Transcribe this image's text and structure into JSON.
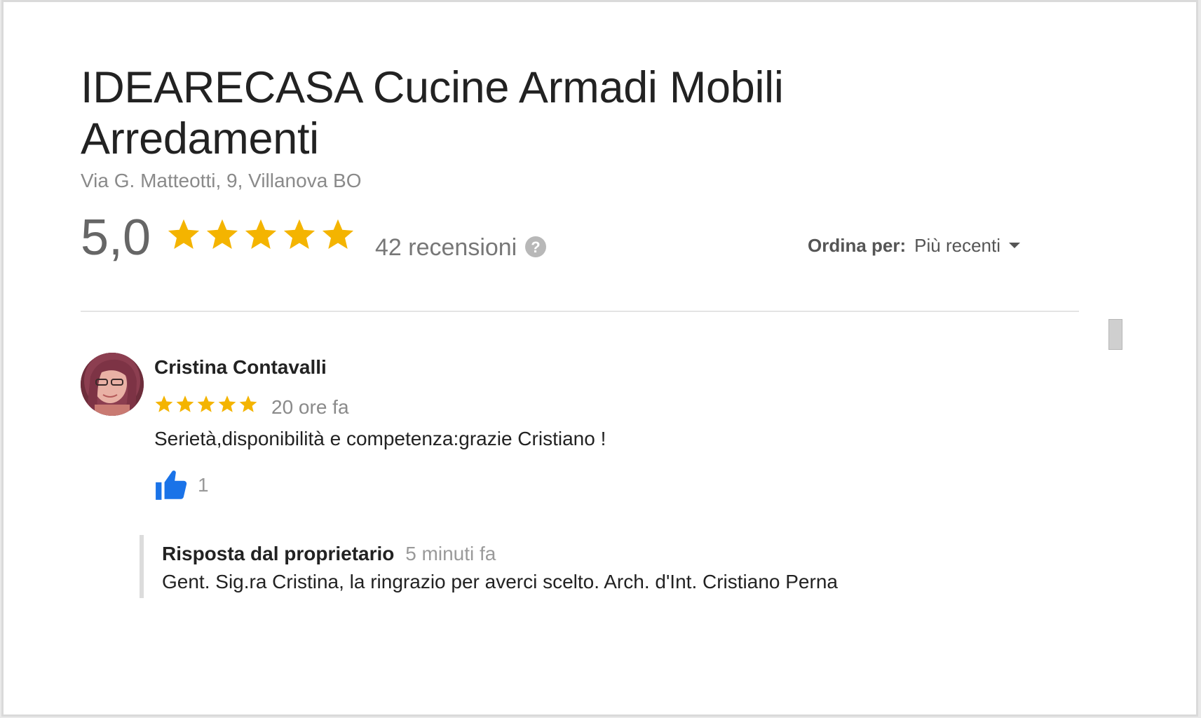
{
  "business": {
    "name": "IDEARECASA Cucine Armadi Mobili Arredamenti",
    "address": "Via G. Matteotti, 9, Villanova BO"
  },
  "summary": {
    "rating": "5,0",
    "stars": 5,
    "review_count_label": "42 recensioni",
    "help_icon": "?"
  },
  "sort": {
    "label": "Ordina per:",
    "value": "Più recenti"
  },
  "reviews": [
    {
      "author": "Cristina Contavalli",
      "stars": 5,
      "time": "20 ore fa",
      "text": "Serietà,disponibilità e competenza:grazie Cristiano !",
      "likes": "1",
      "owner_reply": {
        "label": "Risposta dal proprietario",
        "time": "5 minuti fa",
        "text": "Gent. Sig.ra Cristina, la ringrazio per averci scelto. Arch. d'Int. Cristiano Perna"
      }
    }
  ],
  "colors": {
    "star": "#f4b400",
    "like": "#1a73e8",
    "muted_text": "#8a8a8a"
  },
  "icons": {
    "star": "star-icon",
    "help": "help-icon",
    "sort_caret": "caret-down-icon",
    "like": "thumbs-up-icon"
  }
}
